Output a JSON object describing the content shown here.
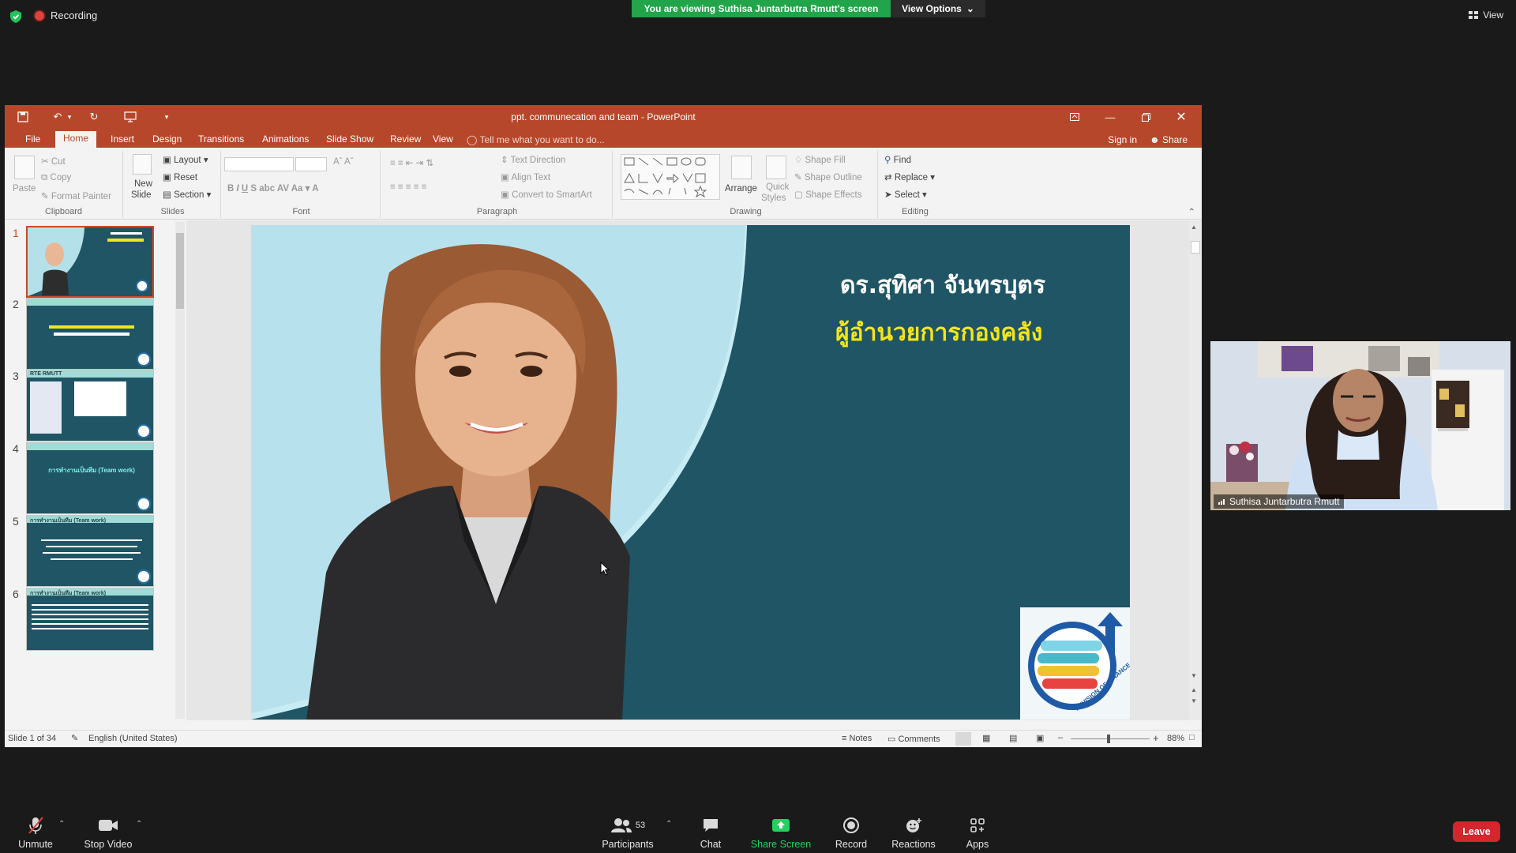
{
  "zoom": {
    "recording_label": "Recording",
    "viewing_banner": "You are viewing Suthisa  Juntarbutra Rmutt's screen",
    "view_options": "View Options",
    "view_label": "View",
    "participants_count": "53",
    "bottom": {
      "unmute": "Unmute",
      "stop_video": "Stop Video",
      "participants": "Participants",
      "chat": "Chat",
      "share_screen": "Share Screen",
      "record": "Record",
      "reactions": "Reactions",
      "apps": "Apps",
      "leave": "Leave"
    },
    "colors": {
      "banner_green": "#22a44a",
      "leave_red": "#d6252c"
    }
  },
  "ppt": {
    "title": "ppt. communecation and team - PowerPoint",
    "tabs": [
      "File",
      "Home",
      "Insert",
      "Design",
      "Transitions",
      "Animations",
      "Slide Show",
      "Review",
      "View"
    ],
    "tell_me": "Tell me what you want to do...",
    "sign_in": "Sign in",
    "share": "Share",
    "ribbon": {
      "clipboard": {
        "label": "Clipboard",
        "paste": "Paste",
        "cut": "Cut",
        "copy": "Copy",
        "format_painter": "Format Painter"
      },
      "slides": {
        "label": "Slides",
        "new_slide": "New",
        "new_slide2": "Slide",
        "layout": "Layout",
        "reset": "Reset",
        "section": "Section"
      },
      "font": {
        "label": "Font"
      },
      "paragraph": {
        "label": "Paragraph",
        "text_direction": "Text Direction",
        "align_text": "Align Text",
        "smartart": "Convert to SmartArt"
      },
      "drawing": {
        "label": "Drawing",
        "arrange": "Arrange",
        "quick_styles": "Quick",
        "quick_styles2": "Styles",
        "shape_fill": "Shape Fill",
        "shape_outline": "Shape Outline",
        "shape_effects": "Shape Effects"
      },
      "editing": {
        "label": "Editing",
        "find": "Find",
        "replace": "Replace",
        "select": "Select"
      }
    },
    "slides": [
      {
        "num": "1",
        "title": "",
        "body": ""
      },
      {
        "num": "2",
        "title": "",
        "body": ""
      },
      {
        "num": "3",
        "title": "RTE RMUTT",
        "body": ""
      },
      {
        "num": "4",
        "title": "",
        "body": "การทำงานเป็นทีม (Team work)"
      },
      {
        "num": "5",
        "title": "การทำงานเป็นทีม (Team work)",
        "body": ""
      },
      {
        "num": "6",
        "title": "การทำงานเป็นทีม (Team work)",
        "body": ""
      }
    ],
    "slide": {
      "title_line1": "ดร.สุทิศา จันทรบุตร",
      "title_line2": "ผู้อำนวยการกองคลัง",
      "logo_text": "DEVISION OF FINANCE"
    },
    "status": {
      "slide_of": "Slide 1 of 34",
      "language": "English (United States)",
      "notes": "Notes",
      "comments": "Comments",
      "zoom_level": "88%"
    }
  },
  "participant": {
    "name": "Suthisa  Juntarbutra Rmutt"
  }
}
